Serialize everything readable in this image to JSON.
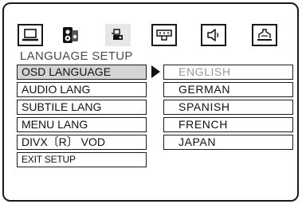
{
  "icons": [
    {
      "name": "language-monitor-icon"
    },
    {
      "name": "speaker-system-icon"
    },
    {
      "name": "video-icon"
    },
    {
      "name": "tv-connector-icon"
    },
    {
      "name": "audio-speaker-icon"
    },
    {
      "name": "preference-icon"
    }
  ],
  "title": "LANGUAGE SETUP",
  "menu": [
    {
      "label": "OSD LANGUAGE"
    },
    {
      "label": "AUDIO LANG"
    },
    {
      "label": "SUBTILE LANG"
    },
    {
      "label": "MENU  LANG"
    },
    {
      "label": "DIVX〔R〕 VOD"
    },
    {
      "label": "EXIT SETUP"
    }
  ],
  "options": [
    {
      "label": "ENGLISH"
    },
    {
      "label": "GERMAN"
    },
    {
      "label": "SPANISH"
    },
    {
      "label": "FRENCH"
    },
    {
      "label": "JAPAN"
    }
  ],
  "colors": {
    "active_bg": "#d4d4d4",
    "current_option": "#9a9a9a",
    "frame": "#1a1a1a"
  }
}
